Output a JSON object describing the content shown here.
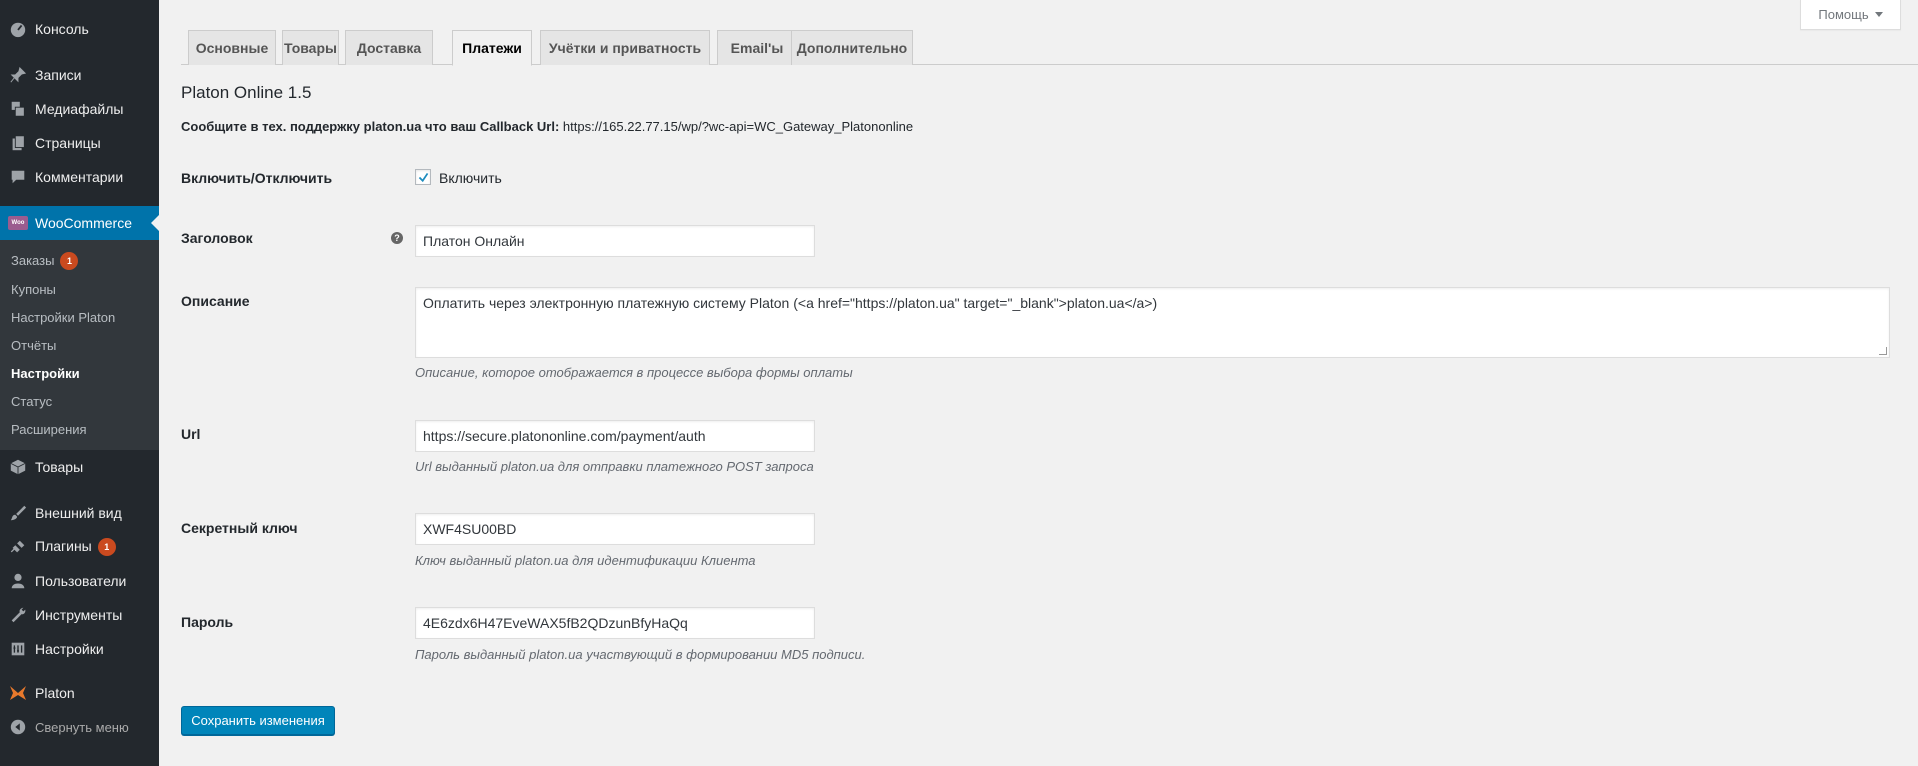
{
  "sidebar": {
    "items": [
      {
        "icon": "dashboard-icon",
        "label": "Консоль"
      },
      {
        "icon": "pin-icon",
        "label": "Записи"
      },
      {
        "icon": "media-icon",
        "label": "Медиафайлы"
      },
      {
        "icon": "page-icon",
        "label": "Страницы"
      },
      {
        "icon": "comment-icon",
        "label": "Комментарии"
      },
      {
        "icon": "woocommerce-logo-icon",
        "label": "WooCommerce"
      },
      {
        "icon": "box-icon",
        "label": "Товары"
      },
      {
        "icon": "brush-icon",
        "label": "Внешний вид"
      },
      {
        "icon": "plugin-icon",
        "label": "Плагины",
        "badge": "1"
      },
      {
        "icon": "user-icon",
        "label": "Пользователи"
      },
      {
        "icon": "wrench-icon",
        "label": "Инструменты"
      },
      {
        "icon": "settings-icon",
        "label": "Настройки"
      },
      {
        "icon": "platon-logo-icon",
        "label": "Platon"
      },
      {
        "icon": "collapse-arrow-icon",
        "label": "Свернуть меню"
      }
    ],
    "woo_logo_text": "Woo",
    "submenu": [
      {
        "label": "Заказы",
        "badge": "1"
      },
      {
        "label": "Купоны"
      },
      {
        "label": "Настройки Platon"
      },
      {
        "label": "Отчёты"
      },
      {
        "label": "Настройки",
        "current": true
      },
      {
        "label": "Статус"
      },
      {
        "label": "Расширения"
      }
    ]
  },
  "help": {
    "label": "Помощь"
  },
  "tabs": [
    "Основные",
    "Товары",
    "Доставка",
    "Платежи",
    "Учётки и приватность",
    "Email'ы",
    "Дополнительно"
  ],
  "active_tab": "Платежи",
  "main": {
    "title": "Platon Online 1.5",
    "notice_bold": "Сообщите в тех. поддержку platon.ua что ваш Callback Url:",
    "notice_url": "https://165.22.77.15/wp/?wc-api=WC_Gateway_Platononline",
    "enable": {
      "label": "Включить/Отключить",
      "checkbox_label": "Включить",
      "checked": true
    },
    "title_field": {
      "label": "Заголовок",
      "help_glyph": "?",
      "value": "Платон Онлайн"
    },
    "description": {
      "label": "Описание",
      "value": "Оплатить через электронную платежную систему Platon (<a href=\"https://platon.ua\" target=\"_blank\">platon.ua</a>)",
      "desc": "Описание, которое отображается в процессе выбора формы оплаты"
    },
    "url": {
      "label": "Url",
      "value": "https://secure.platononline.com/payment/auth",
      "desc": "Url выданный platon.ua для отправки платежного POST запроса"
    },
    "secret": {
      "label": "Секретный ключ",
      "value": "XWF4SU00BD",
      "desc": "Ключ выданный platon.ua для идентификации Клиента"
    },
    "password": {
      "label": "Пароль",
      "value": "4E6zdx6H47EveWAX5fB2QDzunBfyHaQq",
      "desc": "Пароль выданный platon.ua участвующий в формировании MD5 подписи."
    },
    "save_label": "Сохранить изменения"
  },
  "colors": {
    "sidebar_bg": "#23282d",
    "accent": "#0073aa",
    "button": "#0085ba",
    "badge": "#ca4a1f"
  }
}
